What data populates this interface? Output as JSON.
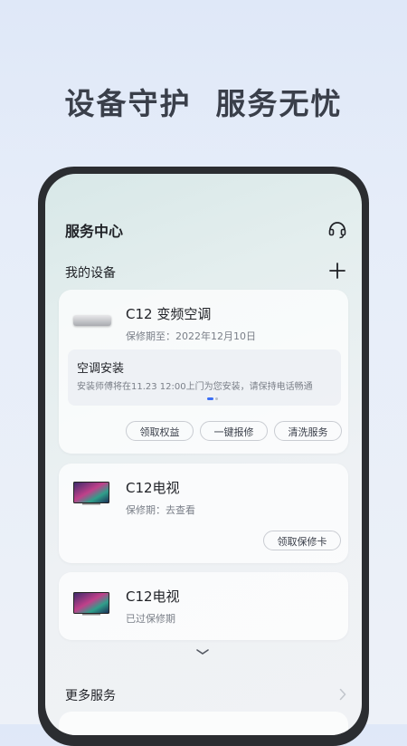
{
  "headline": "设备守护  服务无忧",
  "app": {
    "title": "服务中心",
    "section_title": "我的设备",
    "more_services": "更多服务"
  },
  "devices": [
    {
      "name": "C12 变频空调",
      "warranty": "保修期至：2022年12月10日",
      "icon": "air-conditioner-icon",
      "notice": {
        "title": "空调安装",
        "text": "安装师傅将在11.23 12:00上门为您安装，请保持电话畅通"
      },
      "actions": [
        "领取权益",
        "一键报修",
        "清洗服务"
      ]
    },
    {
      "name": "C12电视",
      "warranty": "保修期：去查看",
      "icon": "tv-icon",
      "actions": [
        "领取保修卡"
      ]
    },
    {
      "name": "C12电视",
      "warranty": "已过保修期",
      "icon": "tv-icon"
    }
  ],
  "colors": {
    "accent": "#3b6ef5",
    "text_primary": "#1f2126",
    "text_secondary": "#7a7f88",
    "phone_frame": "#2b2d31"
  }
}
